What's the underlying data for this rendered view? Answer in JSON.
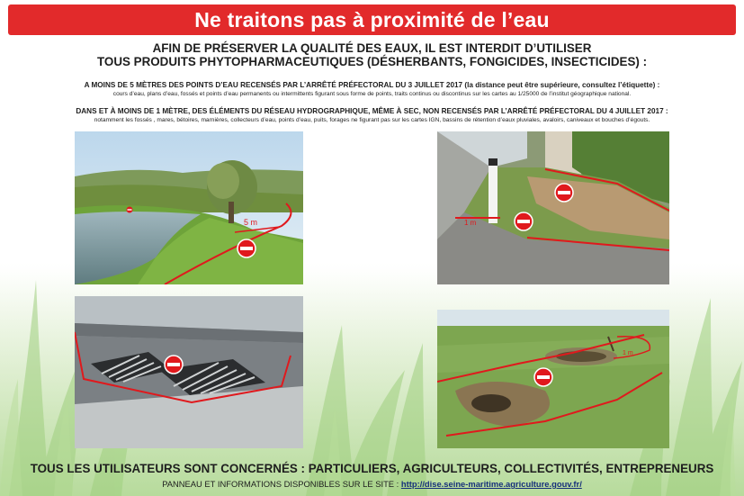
{
  "banner": {
    "title": "Ne traitons pas à proximité de l’eau"
  },
  "intro": {
    "line1": "AFIN DE PRÉSERVER LA QUALITÉ DES EAUX, IL EST INTERDIT D’UTILISER",
    "line2": "TOUS PRODUITS PHYTOPHARMACEUTIQUES (DÉSHERBANTS, FONGICIDES, INSECTICIDES) :"
  },
  "rules": [
    {
      "heading": "A MOINS DE 5 MÈTRES DES POINTS D’EAU RECENSÉS PAR L’ARRÊTÉ PRÉFECTORAL DU 3 JUILLET 2017 (la distance peut être supérieure, consultez l’étiquette) :",
      "detail": "cours d’eau, plans d’eau, fossés et points d’eau permanents ou intermittents figurant sous forme de points, traits continus ou discontinus sur les cartes au 1/25000 de l’institut géographique national."
    },
    {
      "heading": "DANS ET À MOINS DE 1 MÈTRE, DES ÉLÉMENTS DU RÉSEAU HYDROGRAPHIQUE, MÊME À SEC, NON RECENSÉS PAR L’ARRÊTÉ PRÉFECTORAL DU 4 JUILLET 2017 :",
      "detail": "notamment les fossés , mares, bétoires, marnières, collecteurs d’eau, points d’eau, puits, forages ne figurant pas sur les cartes IGN, bassins de rétention d’eaux pluviales, avaloirs, caniveaux et bouches d’égouts."
    }
  ],
  "photos": {
    "river": {
      "label": "5 m"
    },
    "ditch": {
      "label": "1 m"
    },
    "drain": {
      "label": ""
    },
    "pond": {
      "label": "1 m"
    }
  },
  "footer": {
    "line1": "TOUS LES UTILISATEURS SONT CONCERNÉS : PARTICULIERS, AGRICULTEURS, COLLECTIVITÉS, ENTREPRENEURS",
    "line2_prefix": "PANNEAU ET INFORMATIONS DISPONIBLES SUR LE SITE : ",
    "url": "http://dise.seine-maritime.agriculture.gouv.fr/"
  },
  "colors": {
    "banner": "#e22a2b",
    "zone_line": "#e0191d",
    "no_entry_sign": "#e0191d",
    "url": "#16307a"
  },
  "icons": [
    "no-entry-icon"
  ]
}
